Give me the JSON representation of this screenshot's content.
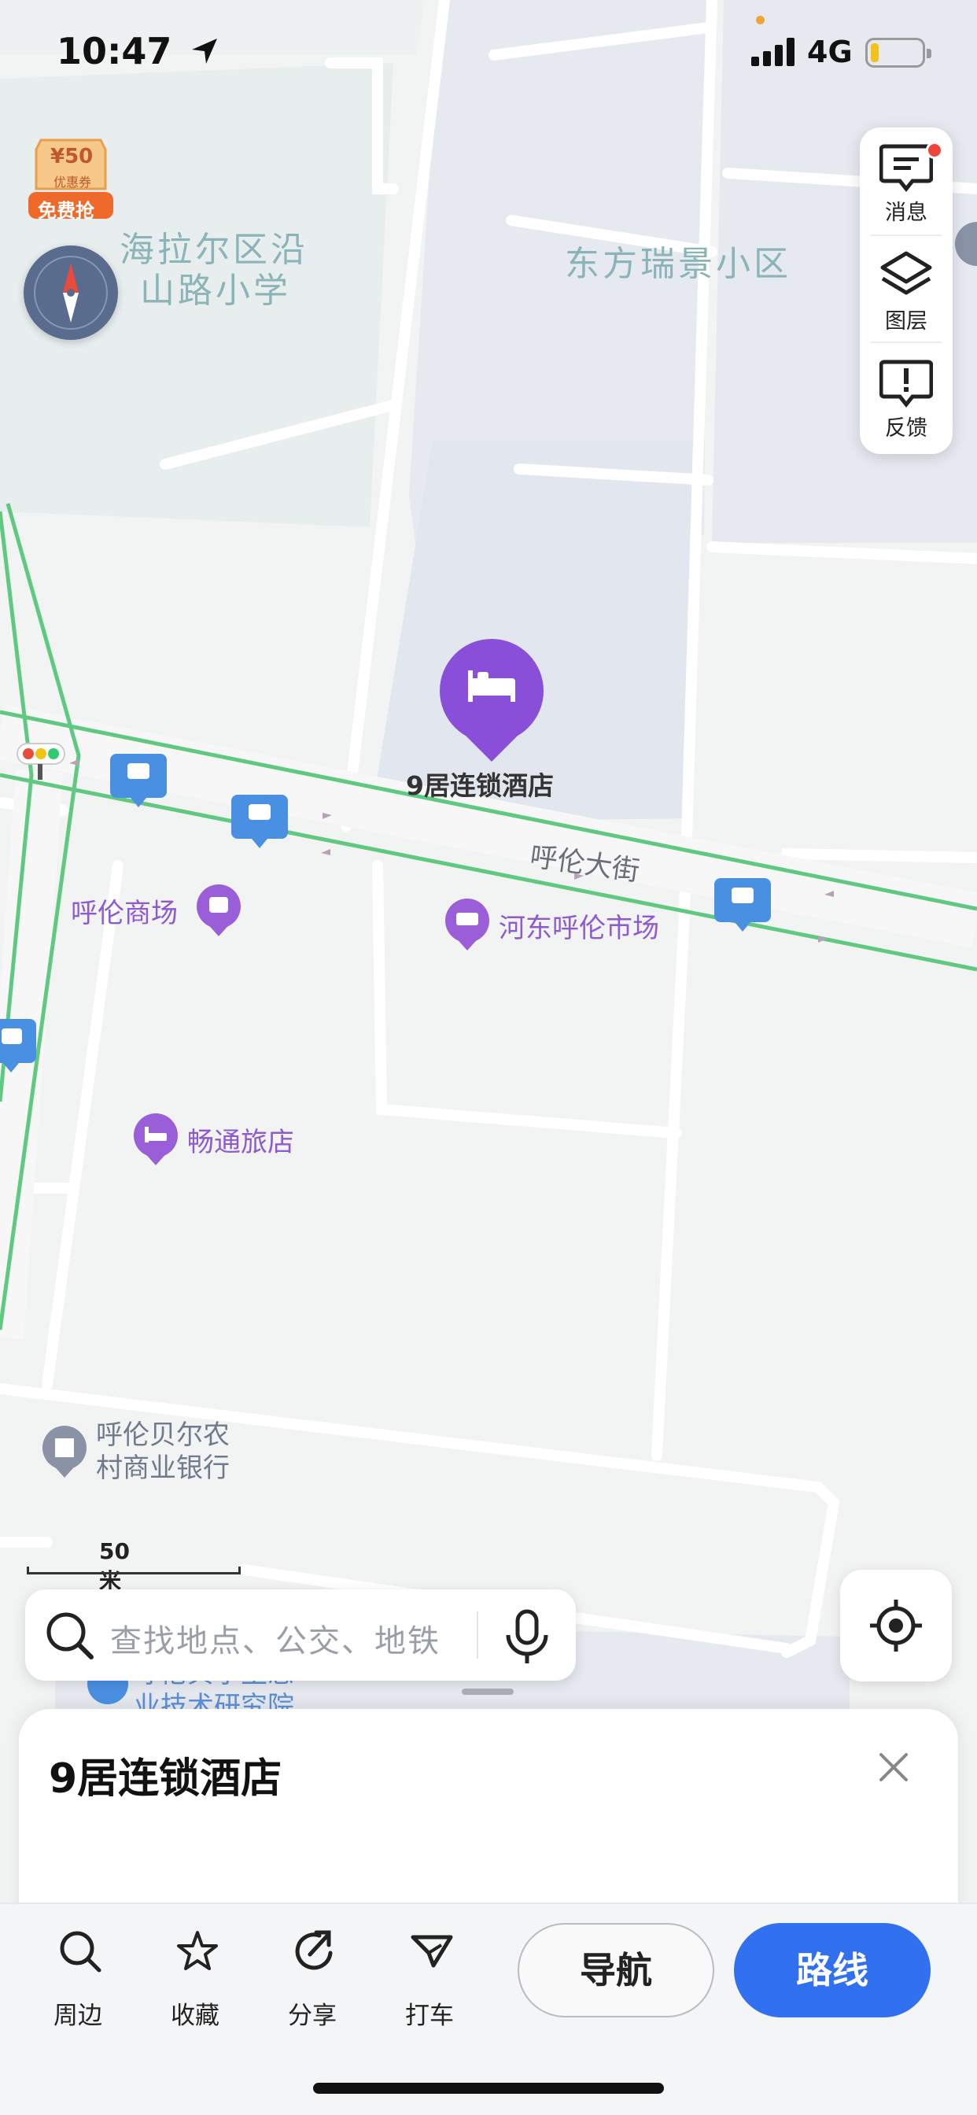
{
  "status_bar": {
    "time": "10:47",
    "network": "4G"
  },
  "coupon": {
    "amount": "¥50",
    "sub": "优惠券",
    "badge": "免费抢"
  },
  "side_panel": [
    {
      "label": "消息",
      "icon": "message-icon"
    },
    {
      "label": "图层",
      "icon": "layers-icon"
    },
    {
      "label": "反馈",
      "icon": "feedback-icon"
    }
  ],
  "map": {
    "areas": [
      {
        "line1": "海拉尔区沿",
        "line2": "山路小学"
      },
      {
        "line1": "东方瑞景小区",
        "line2": ""
      }
    ],
    "selected_poi": "9居连锁酒店",
    "street": "呼伦大街",
    "pois": [
      {
        "name": "呼伦商场",
        "icon": "shopping-bag-icon"
      },
      {
        "name": "河东呼伦市场",
        "icon": "market-icon"
      },
      {
        "name": "畅通旅店",
        "icon": "hotel-icon"
      }
    ],
    "bank": {
      "line1": "呼伦贝尔农",
      "line2": "村商业银行"
    },
    "bottom_poi_fragment": {
      "line1": "呼伦贝尔生态",
      "line2": "业技术研究院"
    }
  },
  "scale": {
    "label": "50 米"
  },
  "search": {
    "placeholder": "查找地点、公交、地铁"
  },
  "sheet": {
    "title": "9居连锁酒店"
  },
  "actions": [
    {
      "label": "周边",
      "icon": "nearby-search-icon"
    },
    {
      "label": "收藏",
      "icon": "star-icon"
    },
    {
      "label": "分享",
      "icon": "share-icon"
    },
    {
      "label": "打车",
      "icon": "taxi-icon"
    }
  ],
  "buttons": {
    "navigate": "导航",
    "route": "路线"
  },
  "colors": {
    "accent": "#3170f0",
    "poi": "#8e5ad2",
    "transit": "#4a90e2",
    "road_green": "#5fc982"
  }
}
